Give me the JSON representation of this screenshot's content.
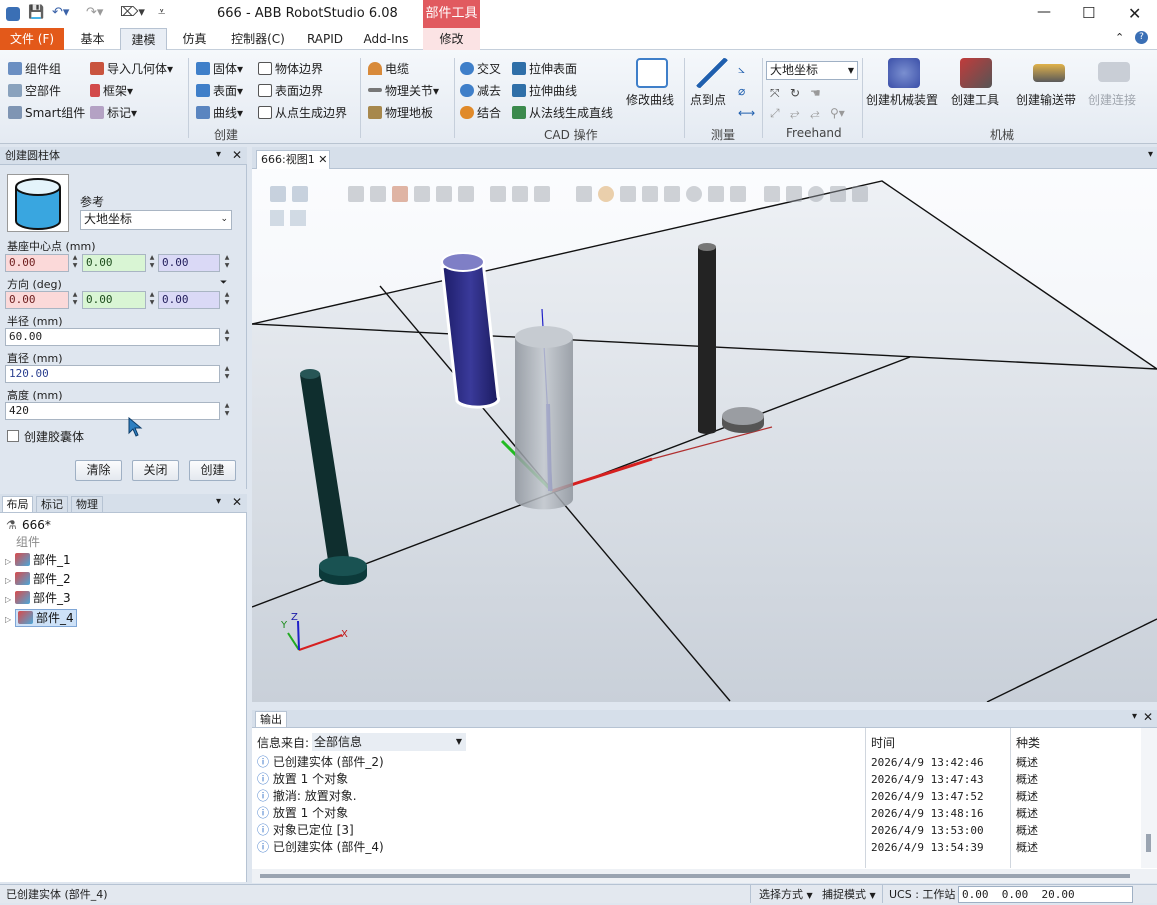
{
  "title": "666 - ABB RobotStudio 6.08",
  "contextual_tab": "部件工具",
  "tabs": {
    "file": "文件 (F)",
    "basic": "基本",
    "modeling": "建模",
    "simulation": "仿真",
    "controller": "控制器(C)",
    "rapid": "RAPID",
    "addins": "Add-Ins",
    "modify": "修改"
  },
  "ribbon": {
    "component_group": "组件组",
    "empty_part": "空部件",
    "smart_component": "Smart组件",
    "import_geometry": "导入几何体",
    "frame": "框架",
    "tag": "标记",
    "solid": "固体",
    "surface": "表面",
    "curve": "曲线",
    "body_bounds": "物体边界",
    "surface_bounds": "表面边界",
    "bounds_from_points": "从点生成边界",
    "cable": "电缆",
    "physics_joint": "物理关节",
    "physics_floor": "物理地板",
    "intersect": "交叉",
    "subtract": "减去",
    "union": "结合",
    "extrude_surface": "拉伸表面",
    "extrude_curve": "拉伸曲线",
    "normal_line": "从法线生成直线",
    "modify_curve": "修改曲线",
    "point_to_point": "点到点",
    "frame_select": "大地坐标",
    "create_mechanism": "创建机械装置",
    "create_tool": "创建工具",
    "create_conveyor": "创建输送带",
    "create_connection": "创建连接",
    "group_create": "创建",
    "group_cad": "CAD 操作",
    "group_measure": "测量",
    "group_freehand": "Freehand",
    "group_mechanism": "机械"
  },
  "create_cylinder": {
    "title": "创建圆柱体",
    "reference_label": "参考",
    "reference_value": "大地坐标",
    "center_label": "基座中心点 (mm)",
    "center": [
      "0.00",
      "0.00",
      "0.00"
    ],
    "orientation_label": "方向 (deg)",
    "orientation": [
      "0.00",
      "0.00",
      "0.00"
    ],
    "radius_label": "半径 (mm)",
    "radius": "60.00",
    "diameter_label": "直径 (mm)",
    "diameter": "120.00",
    "height_label": "高度 (mm)",
    "height": "420",
    "capsule_label": "创建胶囊体",
    "clear": "清除",
    "close": "关闭",
    "create": "创建"
  },
  "layout_panel": {
    "tabs": [
      "布局",
      "标记",
      "物理"
    ],
    "station": "666*",
    "group_label": "组件",
    "items": [
      "部件_1",
      "部件_2",
      "部件_3",
      "部件_4"
    ]
  },
  "view_tab": "666:视图1",
  "output": {
    "tab": "输出",
    "source_label": "信息来自:",
    "source_value": "全部信息",
    "col_time": "时间",
    "col_type": "种类",
    "rows": [
      {
        "msg": "已创建实体 (部件_2)",
        "time": "2026/4/9 13:42:46",
        "type": "概述"
      },
      {
        "msg": "放置 1 个对象",
        "time": "2026/4/9 13:47:43",
        "type": "概述"
      },
      {
        "msg": "撤消: 放置对象.",
        "time": "2026/4/9 13:47:52",
        "type": "概述"
      },
      {
        "msg": "放置 1 个对象",
        "time": "2026/4/9 13:48:16",
        "type": "概述"
      },
      {
        "msg": "对象已定位 [3]",
        "time": "2026/4/9 13:53:00",
        "type": "概述"
      },
      {
        "msg": "已创建实体 (部件_4)",
        "time": "2026/4/9 13:54:39",
        "type": "概述"
      }
    ]
  },
  "status": {
    "message": "已创建实体 (部件_4)",
    "select_mode": "选择方式",
    "snap_mode": "捕捉模式",
    "ucs": "UCS : 工作站",
    "coords": "0.00  0.00  20.00"
  }
}
